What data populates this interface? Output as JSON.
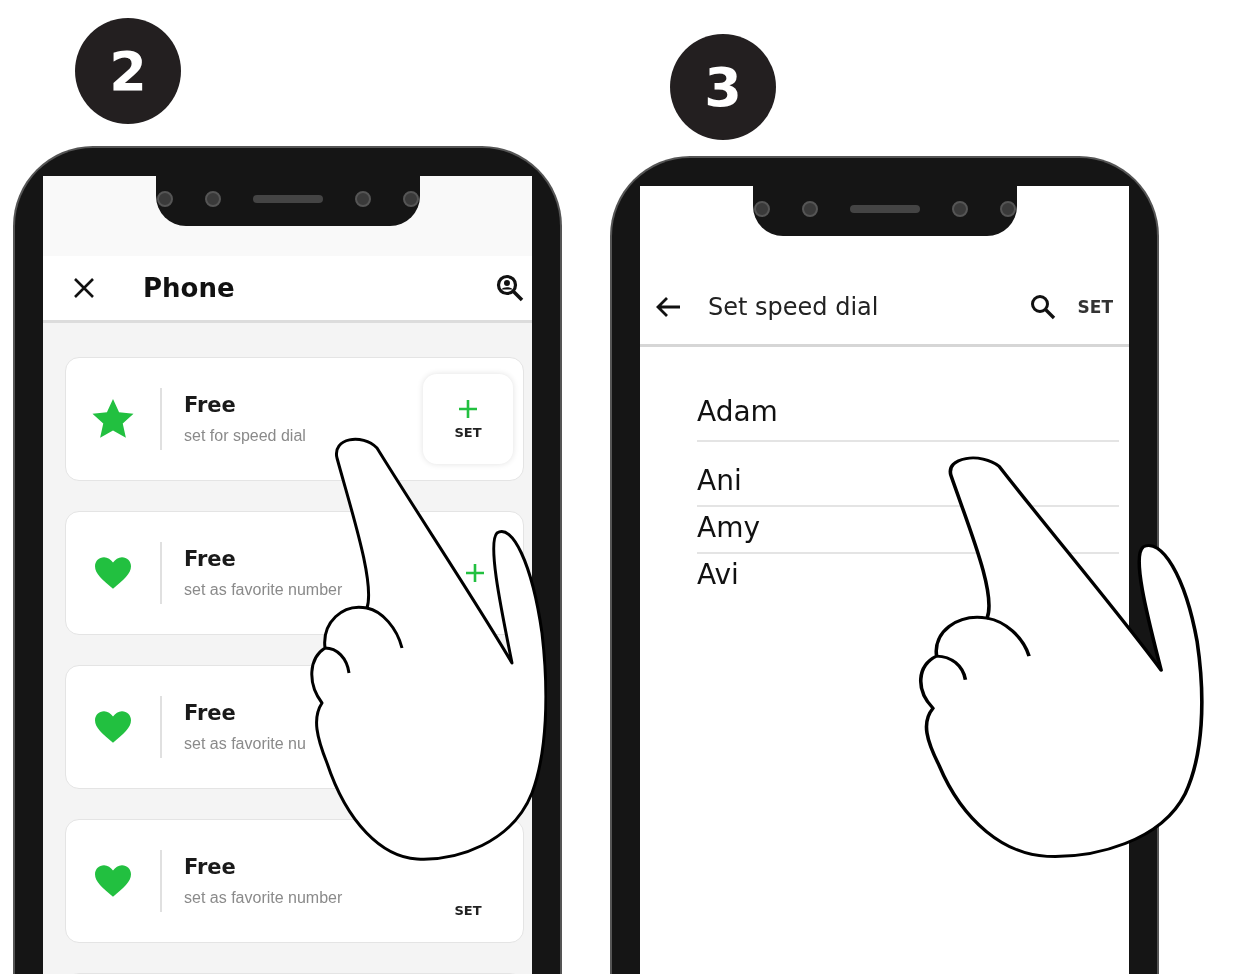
{
  "panels": [
    {
      "kind": "favorites",
      "badge": "2",
      "header": {
        "title": "Phone"
      },
      "cards": [
        {
          "kind": "star",
          "title": "Free",
          "subtitle": "set for speed dial",
          "set_button": {
            "plus": true,
            "label": "SET"
          }
        },
        {
          "kind": "heart",
          "title": "Free",
          "subtitle": "set as favorite number",
          "set_button": {
            "plus": true
          }
        },
        {
          "kind": "heart",
          "title": "Free",
          "subtitle": "set as favorite nu"
        },
        {
          "kind": "heart",
          "title": "Free",
          "subtitle": "set as favorite number",
          "set_button": {
            "plus": false,
            "label": "SET"
          }
        },
        {
          "kind": "empty"
        }
      ]
    },
    {
      "kind": "contacts",
      "badge": "3",
      "header": {
        "title": "Set speed dial",
        "action": "SET"
      },
      "contacts": [
        "Adam",
        "Ani",
        "Amy",
        "Avi"
      ]
    }
  ]
}
